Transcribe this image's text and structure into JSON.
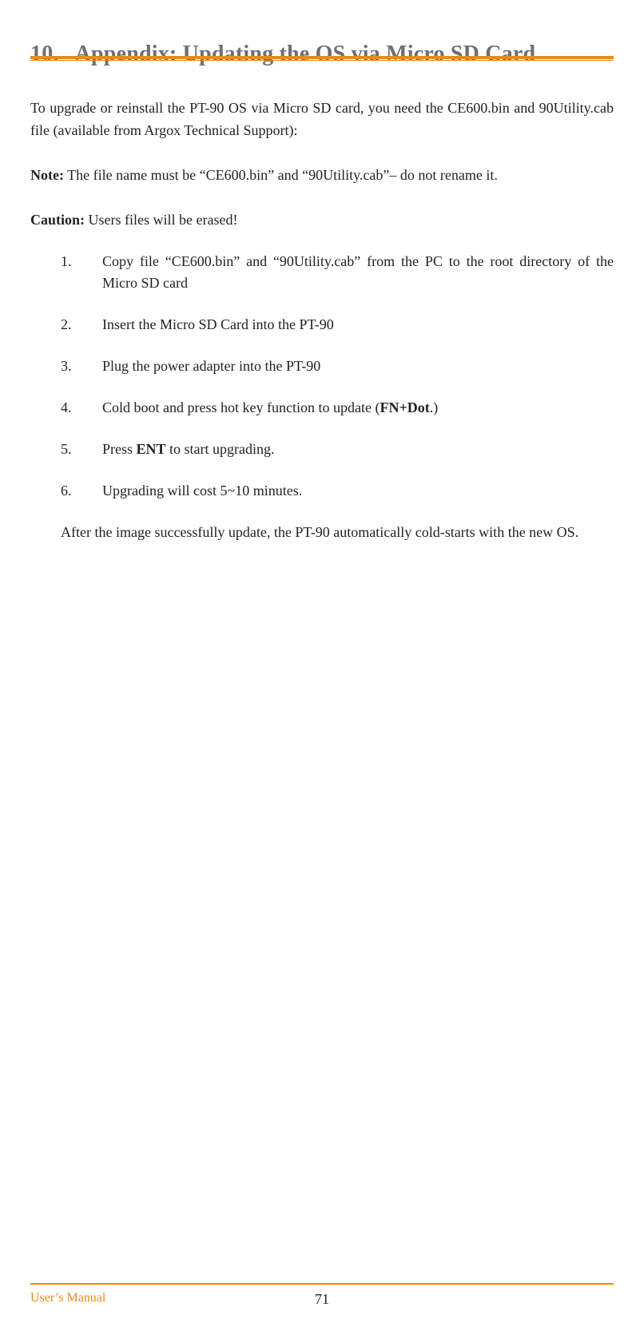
{
  "heading": {
    "number": "10.",
    "title": "Appendix: Updating the OS via Micro SD Card"
  },
  "intro": "To upgrade or reinstall the PT-90 OS via Micro SD card, you need the CE600.bin and 90Utility.cab file (available from Argox Technical Support):",
  "note": {
    "label": "Note:",
    "text": " The file name must be “CE600.bin” and “90Utility.cab”– do not rename it."
  },
  "caution": {
    "label": "Caution:",
    "text": " Users files will be erased!"
  },
  "steps": [
    {
      "prefix": "Copy file “CE600.bin” and “90Utility.cab” from the PC to the root directory of the Micro SD card",
      "bold": "",
      "suffix": ""
    },
    {
      "prefix": "Insert the Micro SD Card into the PT-90",
      "bold": "",
      "suffix": ""
    },
    {
      "prefix": "Plug the power adapter into the PT-90",
      "bold": "",
      "suffix": ""
    },
    {
      "prefix": "Cold boot and press hot key function to update (",
      "bold": "FN+Dot",
      "suffix": ".)"
    },
    {
      "prefix": "Press ",
      "bold": "ENT",
      "suffix": " to start upgrading."
    },
    {
      "prefix": "Upgrading will cost 5~10 minutes.",
      "bold": "",
      "suffix": ""
    }
  ],
  "closing": "After the image successfully update, the PT-90 automatically cold-starts with the new OS.",
  "footer": {
    "left": "User’s Manual",
    "page": "71"
  }
}
